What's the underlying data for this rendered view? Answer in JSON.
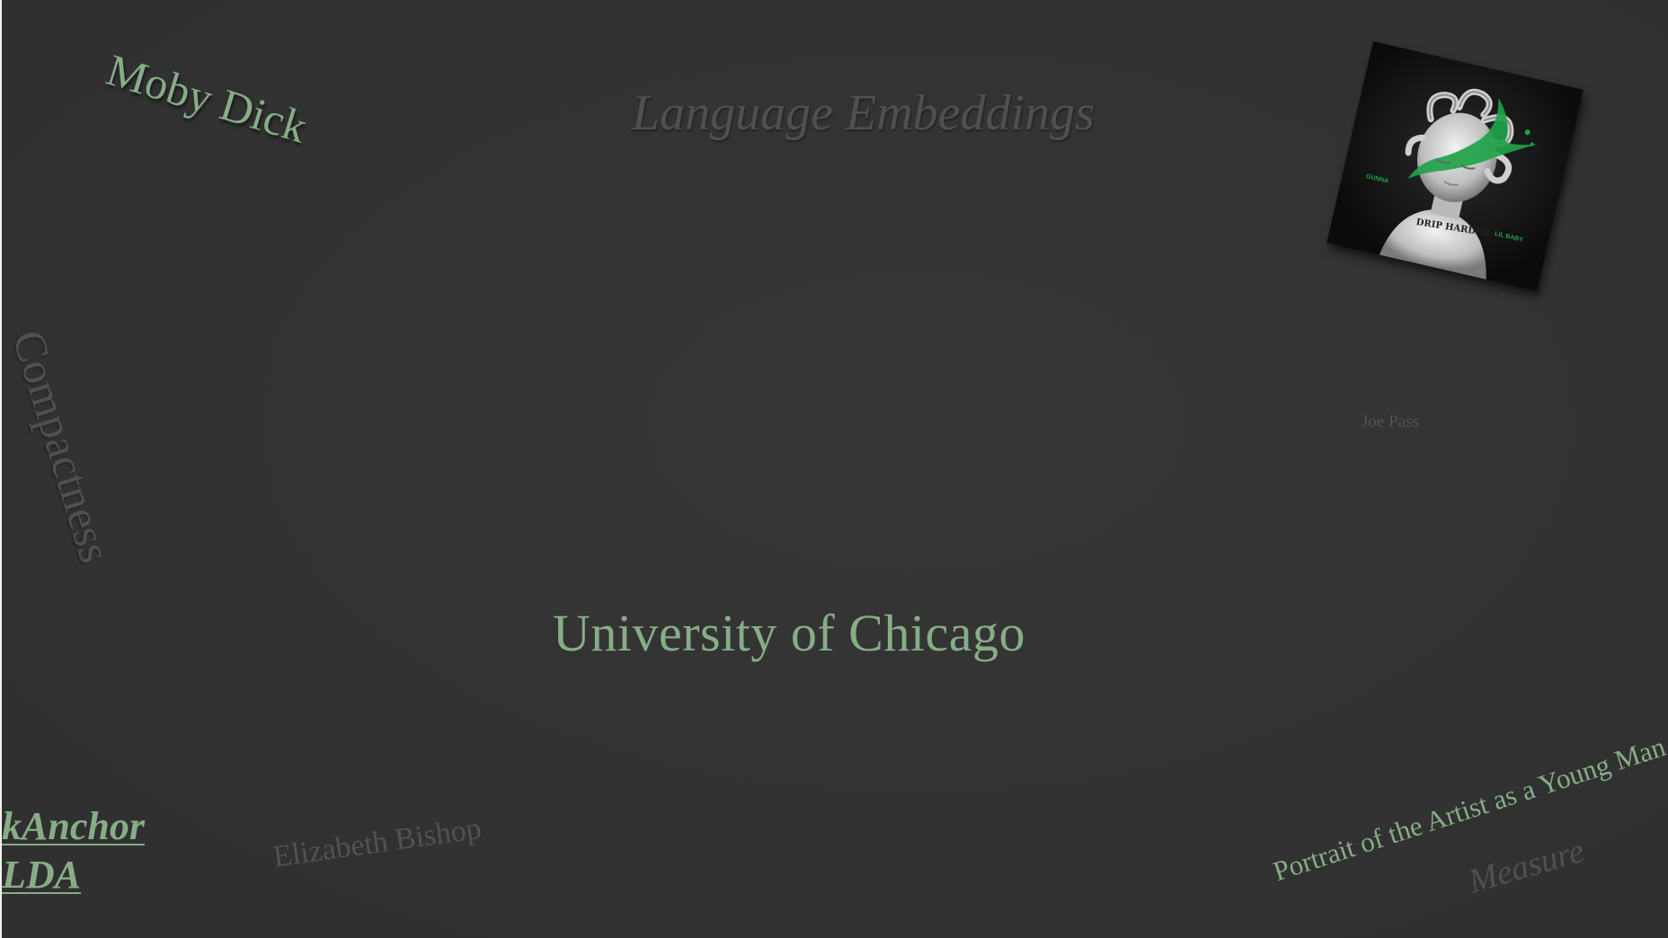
{
  "words": {
    "moby_dick": "Moby Dick",
    "language_embeddings": "Language Embeddings",
    "compactness": "Compactness",
    "joe_pass": "Joe Pass",
    "university": "University of Chicago",
    "elizabeth_bishop": "Elizabeth Bishop",
    "portrait": "Portrait of the Artist as a Young Man",
    "measure": "Measure"
  },
  "links": [
    {
      "label": "kAnchor"
    },
    {
      "label": "LDA"
    }
  ],
  "album_cover": {
    "icon": "album-cover-icon",
    "artist_left": "GUNNA",
    "artist_right": "LIL BABY",
    "title": "DRIP HARDER",
    "colors": {
      "background": "#111111",
      "accent": "#1fa34a"
    }
  },
  "colors": {
    "background": "#333333",
    "accent_green": "#87ad86",
    "muted_gray": "#505050"
  }
}
